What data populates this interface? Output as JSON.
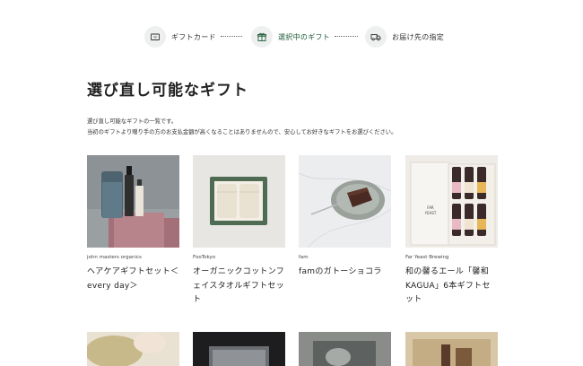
{
  "steps": [
    {
      "label": "ギフトカード",
      "icon": "gift-card-icon"
    },
    {
      "label": "選択中のギフト",
      "icon": "gift-box-icon"
    },
    {
      "label": "お届け先の指定",
      "icon": "truck-icon"
    }
  ],
  "title": "選び直し可能なギフト",
  "description": [
    "選び直し可能なギフトの一覧です。",
    "当初のギフトより贈り手の方のお支払金額が高くなることはありませんので、安心してお好きなギフトをお選びください。"
  ],
  "products": [
    {
      "brand": "john masters organics",
      "name": "ヘアケアギフトセット＜every day＞"
    },
    {
      "brand": "FooTokyo",
      "name": "オーガニックコットンフェイスタオルギフトセット"
    },
    {
      "brand": "fam",
      "name": "famのガトーショコラ"
    },
    {
      "brand": "Far Yeast Brewing",
      "name": "和の馨るエール「馨和 KAGUA」6本ギフトセット"
    }
  ],
  "colors": {
    "accent": "#1e5a3a",
    "icon_bg": "#eef0ef"
  }
}
